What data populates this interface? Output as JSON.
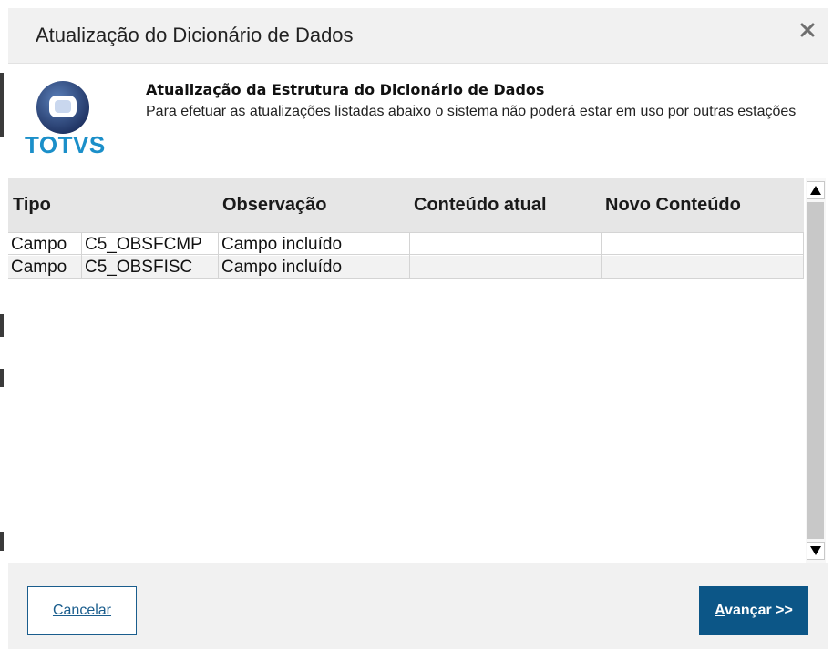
{
  "dialog": {
    "title": "Atualização do Dicionário de Dados",
    "close_icon": "close-icon"
  },
  "info": {
    "logo_text": "TOTVS",
    "heading": "Atualização da Estrutura do Dicionário de Dados",
    "description": "Para efetuar as atualizações listadas abaixo o sistema não poderá estar em uso por outras estações"
  },
  "grid": {
    "columns": [
      "Tipo",
      "Observação",
      "Conteúdo atual",
      "Novo Conteúdo"
    ],
    "rows": [
      {
        "tipo": "Campo",
        "campo": "C5_OBSFCMP",
        "observacao": "Campo incluído",
        "conteudo_atual": "",
        "novo_conteudo": ""
      },
      {
        "tipo": "Campo",
        "campo": "C5_OBSFISC",
        "observacao": "Campo incluído",
        "conteudo_atual": "",
        "novo_conteudo": ""
      }
    ]
  },
  "footer": {
    "cancel_first": "C",
    "cancel_rest": "ancelar",
    "next_first": "A",
    "next_rest": "vançar >>"
  },
  "colors": {
    "accent": "#0c5687",
    "logo_blue": "#1b8fc9",
    "header_bg": "#f1f1f1"
  }
}
